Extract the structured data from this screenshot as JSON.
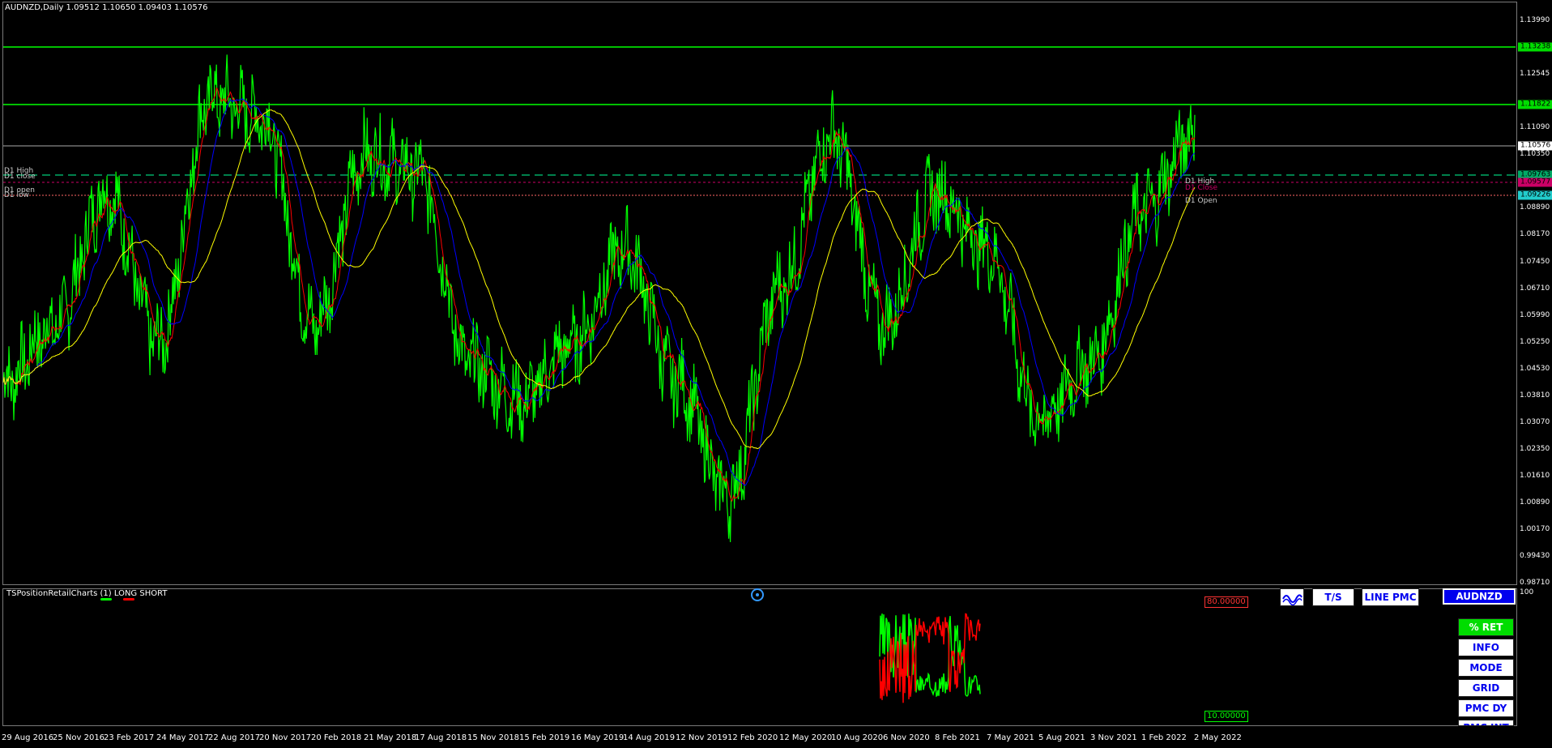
{
  "header": {
    "title": "AUDNZD,Daily  1.09512 1.10650 1.09403 1.10576"
  },
  "price_axis": [
    "1.13990",
    "1.13238",
    "1.12545",
    "1.11822",
    "1.11090",
    "1.10576",
    "1.10350",
    "1.09763",
    "1.09577",
    "1.09226",
    "1.08890",
    "1.08170",
    "1.07450",
    "1.06710",
    "1.05990",
    "1.05250",
    "1.04530",
    "1.03810",
    "1.03070",
    "1.02350",
    "1.01610",
    "1.00890",
    "1.00170",
    "0.99430",
    "0.98710"
  ],
  "price_tags": {
    "line1": "1.13238",
    "line2": "1.11822",
    "current": "1.10576",
    "d1_high": "1.09763",
    "d1_close": "1.09577",
    "d1_open": "1.09226"
  },
  "levels_left": {
    "high": "D1 High",
    "close": "D1 close",
    "open": "D1 open",
    "low": "D1 low"
  },
  "levels_right": {
    "high": "D1 High",
    "close": "D1 Close",
    "open": "D1 Open"
  },
  "date_axis": [
    "29 Aug 2016",
    "25 Nov 2016",
    "23 Feb 2017",
    "24 May 2017",
    "22 Aug 2017",
    "20 Nov 2017",
    "20 Feb 2018",
    "21 May 2018",
    "17 Aug 2018",
    "15 Nov 2018",
    "15 Feb 2019",
    "16 May 2019",
    "14 Aug 2019",
    "12 Nov 2019",
    "12 Feb 2020",
    "12 May 2020",
    "10 Aug 2020",
    "6 Nov 2020",
    "8 Feb 2021",
    "7 May 2021",
    "5 Aug 2021",
    "3 Nov 2021",
    "1 Feb 2022",
    "2 May 2022"
  ],
  "indicator": {
    "title": "TSPositionRetailCharts (1) LONG SHORT",
    "axis_top": "100",
    "upper_level": "80.00000",
    "lower_level": "10.00000",
    "colors": {
      "long": "#00ff00",
      "short": "#ff0000"
    }
  },
  "buttons": {
    "icon_label": "",
    "ts": "T/S",
    "line_pmc": "LINE PMC",
    "symbol": "AUDNZD",
    "pct_ret": "% RET",
    "info": "INFO",
    "mode": "MODE",
    "grid": "GRID",
    "pmc_dy": "PMC DY",
    "pmc_int": "PMC INT"
  },
  "colors": {
    "price": "#00ff00",
    "ma_fast": "#ff0000",
    "ma_mid": "#0000ff",
    "ma_slow": "#ffff00",
    "level_green": "#00ff00"
  },
  "chart_data": {
    "type": "line",
    "title": "AUDNZD,Daily",
    "x": [
      "29 Aug 2016",
      "25 Nov 2016",
      "23 Feb 2017",
      "24 May 2017",
      "22 Aug 2017",
      "20 Nov 2017",
      "20 Feb 2018",
      "21 May 2018",
      "17 Aug 2018",
      "15 Nov 2018",
      "15 Feb 2019",
      "16 May 2019",
      "14 Aug 2019",
      "12 Nov 2019",
      "12 Feb 2020",
      "12 May 2020",
      "10 Aug 2020",
      "6 Nov 2020",
      "8 Feb 2021",
      "7 May 2021",
      "5 Aug 2021",
      "3 Nov 2021",
      "1 Feb 2022",
      "2 May 2022"
    ],
    "series": [
      {
        "values": [
          1.04,
          1.055,
          1.09,
          1.05,
          1.115,
          1.11,
          1.055,
          1.1,
          1.095,
          1.045,
          1.035,
          1.05,
          1.075,
          1.04,
          1.01,
          1.065,
          1.105,
          1.055,
          1.09,
          1.075,
          1.03,
          1.045,
          1.085,
          1.106
        ]
      }
    ],
    "ylim": [
      0.9871,
      1.1399
    ]
  }
}
